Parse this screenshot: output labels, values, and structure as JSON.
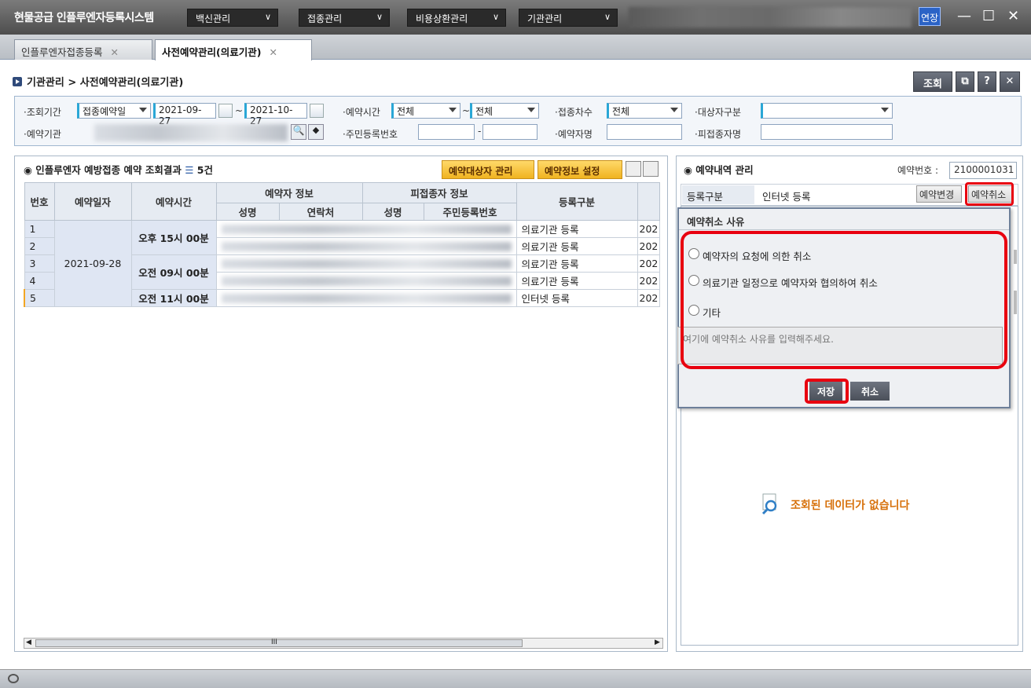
{
  "titlebar": {
    "app_title": "현물공급 인플루엔자등록시스템",
    "menus": [
      "백신관리",
      "접종관리",
      "비용상환관리",
      "기관관리"
    ],
    "extend_label": "연장"
  },
  "tabs": [
    {
      "label": "인플루엔자접종등록"
    },
    {
      "label": "사전예약관리(의료기관)"
    }
  ],
  "breadcrumb": "기관관리 > 사전예약관리(의료기관)",
  "toolbar": {
    "search_label": "조회",
    "help_label": "?"
  },
  "search": {
    "period_label": "·조회기간",
    "period_type": "접종예약일",
    "date_from": "2021-09-27",
    "date_sep": "~",
    "date_to": "2021-10-27",
    "time_label": "·예약시간",
    "time_from": "전체",
    "time_to": "전체",
    "dose_label": "·접종차수",
    "dose_value": "전체",
    "target_label": "·대상자구분",
    "target_value": "",
    "inst_label": "·예약기관",
    "rrn_label": "·주민등록번호",
    "rrn_sep": "-",
    "reserver_label": "·예약자명",
    "vaccinee_label": "·피접종자명"
  },
  "left": {
    "title": "인플루엔자 예방접종 예약 조회결과",
    "count": "5건",
    "btn_target_mgmt": "예약대상자 관리",
    "btn_info_setting": "예약정보 설정",
    "headers": {
      "no": "번호",
      "date": "예약일자",
      "time": "예약시간",
      "reserver": "예약자 정보",
      "vaccinee": "피접종자 정보",
      "name": "성명",
      "contact": "연락처",
      "rrn": "주민등록번호",
      "reg_type": "등록구분"
    },
    "date_value": "2021-09-28",
    "times": [
      "오후 15시 00분",
      "오전 09시 00분",
      "오전 11시 00분"
    ],
    "rows": [
      {
        "no": "1",
        "reg": "의료기관 등록",
        "extra": "202"
      },
      {
        "no": "2",
        "reg": "의료기관 등록",
        "extra": "202"
      },
      {
        "no": "3",
        "reg": "의료기관 등록",
        "extra": "202"
      },
      {
        "no": "4",
        "reg": "의료기관 등록",
        "extra": "202"
      },
      {
        "no": "5",
        "reg": "인터넷 등록",
        "extra": "202"
      }
    ],
    "scroll_mark": "III"
  },
  "right": {
    "title": "예약내역 관리",
    "resno_label": "예약번호 :",
    "resno_value": "2100001031",
    "reg_label": "등록구분",
    "reg_value": "인터넷 등록",
    "btn_change": "예약변경",
    "btn_cancel": "예약취소",
    "no_data": "조회된 데이터가 없습니다"
  },
  "popup": {
    "title": "예약취소 사유",
    "options": [
      "예약자의 요청에 의한 취소",
      "의료기관 일정으로 예약자와 협의하여 취소",
      "기타"
    ],
    "reason_placeholder": "여기에 예약취소 사유를 입력해주세요.",
    "save_label": "저장",
    "cancel_label": "취소"
  },
  "colors": {
    "highlight": "#e8000f",
    "accent_yellow": "#f0b320",
    "selected_row": "#f2a623"
  }
}
